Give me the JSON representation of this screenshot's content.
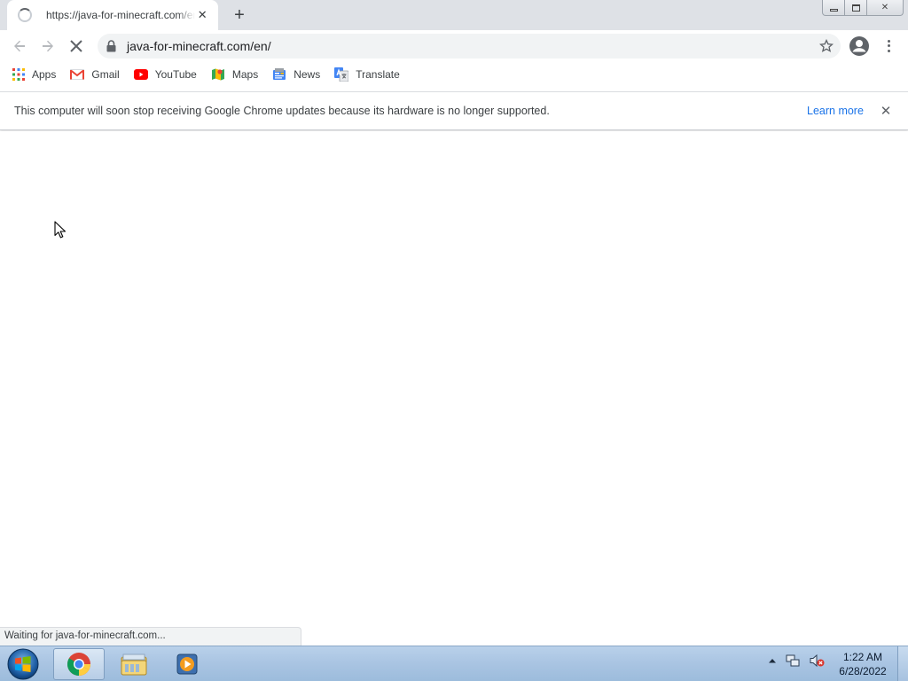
{
  "tab": {
    "title": "https://java-for-minecraft.com/en/",
    "close_glyph": "✕",
    "new_tab_glyph": "+"
  },
  "window_controls": {
    "minimize": "minimize-icon",
    "maximize": "restore-icon",
    "close_glyph": "✕"
  },
  "toolbar": {
    "url": "java-for-minecraft.com/en/",
    "icons": [
      "back-arrow-icon",
      "forward-arrow-icon",
      "stop-icon",
      "lock-icon",
      "star-icon",
      "profile-icon",
      "menu-icon"
    ]
  },
  "bookmarks": [
    {
      "label": "Apps",
      "icon": "apps-grid-icon"
    },
    {
      "label": "Gmail",
      "icon": "gmail-icon"
    },
    {
      "label": "YouTube",
      "icon": "youtube-icon"
    },
    {
      "label": "Maps",
      "icon": "maps-icon"
    },
    {
      "label": "News",
      "icon": "news-icon"
    },
    {
      "label": "Translate",
      "icon": "translate-icon"
    }
  ],
  "infobar": {
    "message": "This computer will soon stop receiving Google Chrome updates because its hardware is no longer supported.",
    "link": "Learn more",
    "close_glyph": "✕"
  },
  "status": {
    "text": "Waiting for java-for-minecraft.com..."
  },
  "taskbar": {
    "apps": [
      "chrome-icon",
      "file-explorer-icon",
      "media-player-icon"
    ],
    "clock_time": "1:22 AM",
    "clock_date": "6/28/2022"
  },
  "colors": {
    "tabstrip_bg": "#dee1e6",
    "link_blue": "#1a73e8",
    "taskbar_blue": "#a9c4e2"
  }
}
